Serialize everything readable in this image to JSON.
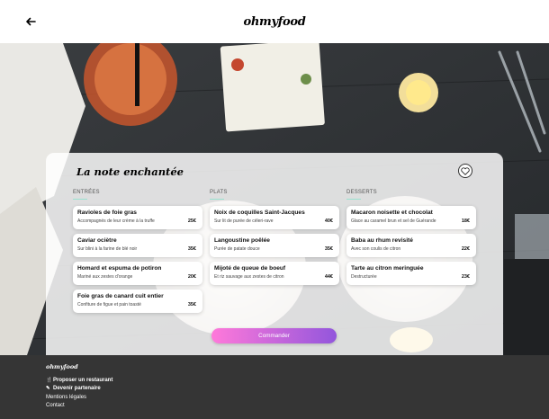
{
  "header": {
    "logo": "ohmyfood",
    "back_icon": "arrow-left-icon"
  },
  "card": {
    "title": "La note enchantée",
    "favorite_icon": "heart-icon",
    "columns": [
      {
        "title": "ENTRÉES",
        "dishes": [
          {
            "name": "Ravioles de foie gras",
            "desc": "Accompagnés de leur crème à la truffe",
            "price": "25€"
          },
          {
            "name": "Caviar ociètre",
            "desc": "Sur blini à la farine de blé noir",
            "price": "35€"
          },
          {
            "name": "Homard et espuma de potiron",
            "desc": "Mariné aux zestes d'orange",
            "price": "20€"
          },
          {
            "name": "Foie gras de canard cuit entier",
            "desc": "Confiture de figue et pain toasté",
            "price": "35€"
          }
        ]
      },
      {
        "title": "PLATS",
        "dishes": [
          {
            "name": "Noix de coquilles Saint-Jacques",
            "desc": "Sur lit de purée de céleri-rave",
            "price": "40€"
          },
          {
            "name": "Langoustine poêlée",
            "desc": "Purée de patate douce",
            "price": "35€"
          },
          {
            "name": "Mijoté de queue de boeuf",
            "desc": "Et riz sauvage aux zestes de citron",
            "price": "44€"
          }
        ]
      },
      {
        "title": "DESSERTS",
        "dishes": [
          {
            "name": "Macaron noisette et chocolat",
            "desc": "Glace au caramel brun et sel de Guérande",
            "price": "18€"
          },
          {
            "name": "Baba au rhum revisité",
            "desc": "Avec son coulis de citron",
            "price": "22€"
          },
          {
            "name": "Tarte au citron meringuée",
            "desc": "Destructurée",
            "price": "23€"
          }
        ]
      }
    ],
    "order_label": "Commander"
  },
  "footer": {
    "logo": "ohmyfood",
    "links": [
      {
        "icon": "utensils-icon",
        "glyph": "🍴",
        "label": "Proposer un restaurant"
      },
      {
        "icon": "handshake-icon",
        "glyph": "✎",
        "label": "Devenir partenaire"
      },
      {
        "icon": "",
        "glyph": "",
        "label": "Mentions légales"
      },
      {
        "icon": "",
        "glyph": "",
        "label": "Contact"
      }
    ]
  },
  "colors": {
    "accent_start": "#ff79da",
    "accent_end": "#9356dc",
    "underline": "#99e2d0",
    "footer_bg": "#353535"
  }
}
